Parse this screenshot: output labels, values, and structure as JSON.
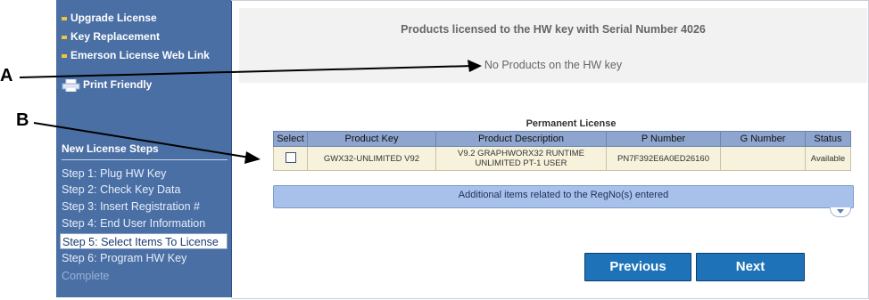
{
  "sidebar": {
    "links": [
      {
        "label": "Upgrade License"
      },
      {
        "label": "Key Replacement"
      },
      {
        "label": "Emerson License Web Link"
      }
    ],
    "print_label": "Print Friendly",
    "steps_title": "New License Steps",
    "steps": [
      {
        "label": "Step 1: Plug HW Key"
      },
      {
        "label": "Step 2: Check Key Data"
      },
      {
        "label": "Step 3: Insert Registration #"
      },
      {
        "label": "Step 4: End User Information"
      },
      {
        "label": "Step 5: Select Items To License"
      },
      {
        "label": "Step 6: Program HW Key"
      },
      {
        "label": "Complete"
      }
    ],
    "active_step_index": 4
  },
  "hw_key": {
    "title": "Products licensed to the HW key with Serial Number 4026",
    "message": "No Products on the HW key"
  },
  "permanent_license": {
    "title": "Permanent License",
    "columns": [
      "Select",
      "Product Key",
      "Product Description",
      "P Number",
      "G Number",
      "Status"
    ],
    "rows": [
      {
        "selected": false,
        "product_key": "GWX32-UNLIMITED V92",
        "product_description": "V9.2 GRAPHWORX32 RUNTIME UNLIMITED PT-1 USER",
        "p_number": "PN7F392E6A0ED26160",
        "g_number": "",
        "status": "Available"
      }
    ]
  },
  "additional_items": {
    "label": "Additional items related to the RegNo(s) entered"
  },
  "buttons": {
    "previous": "Previous",
    "next": "Next"
  },
  "annotations": {
    "a": "A",
    "b": "B"
  },
  "colors": {
    "sidebar_bg": "#4a6fa4",
    "bullet": "#f2c23a",
    "table_header": "#8ea6cf",
    "row_bg": "#f7f2dc",
    "button": "#1e73b8"
  },
  "icons": {
    "bullet": "square-bullet-icon",
    "print": "printer-icon",
    "checkbox": "checkbox-icon",
    "scroll": "chevron-down-icon"
  }
}
